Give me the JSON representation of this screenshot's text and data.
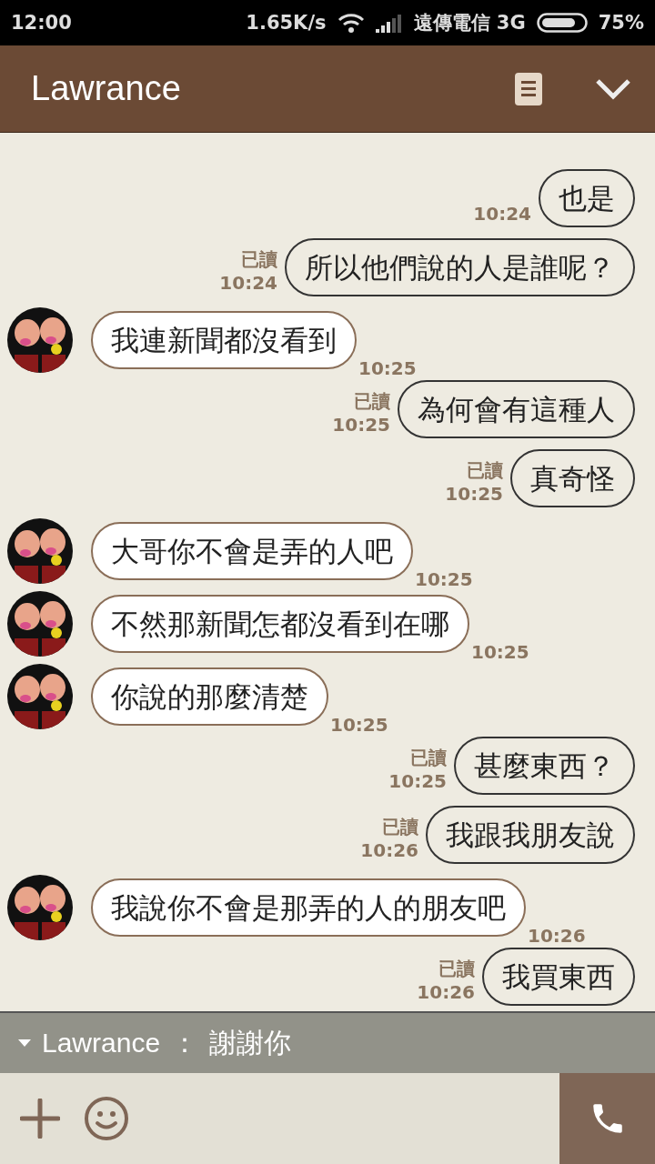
{
  "status_bar": {
    "time": "12:00",
    "speed": "1.65K/s",
    "carrier": "遠傳電信 3G",
    "battery": "75%"
  },
  "header": {
    "title": "Lawrance"
  },
  "messages": [
    {
      "kind": "sent",
      "text": "也是",
      "time": "10:24"
    },
    {
      "kind": "sent",
      "text": "所以他們說的人是誰呢？",
      "read_label": "已讀",
      "time": "10:24"
    },
    {
      "kind": "received",
      "text": "我連新聞都沒看到",
      "time": "10:25"
    },
    {
      "kind": "sent",
      "text": "為何會有這種人",
      "read_label": "已讀",
      "time": "10:25"
    },
    {
      "kind": "sent",
      "text": "真奇怪",
      "read_label": "已讀",
      "time": "10:25"
    },
    {
      "kind": "received",
      "text": "大哥你不會是弄的人吧",
      "time": "10:25"
    },
    {
      "kind": "received",
      "text": "不然那新聞怎都沒看到在哪",
      "time": "10:25"
    },
    {
      "kind": "received",
      "text": "你說的那麼清楚",
      "time": "10:25"
    },
    {
      "kind": "sent",
      "text": "甚麼東西？",
      "read_label": "已讀",
      "time": "10:25"
    },
    {
      "kind": "sent",
      "text": "我跟我朋友說",
      "read_label": "已讀",
      "time": "10:26"
    },
    {
      "kind": "received",
      "text": "我說你不會是那弄的人的朋友吧",
      "time": "10:26"
    },
    {
      "kind": "sent",
      "text": "我買東西",
      "read_label": "已讀",
      "time": "10:26"
    }
  ],
  "notification": {
    "sender": "Lawrance",
    "separator": "：",
    "text": "謝謝你"
  }
}
